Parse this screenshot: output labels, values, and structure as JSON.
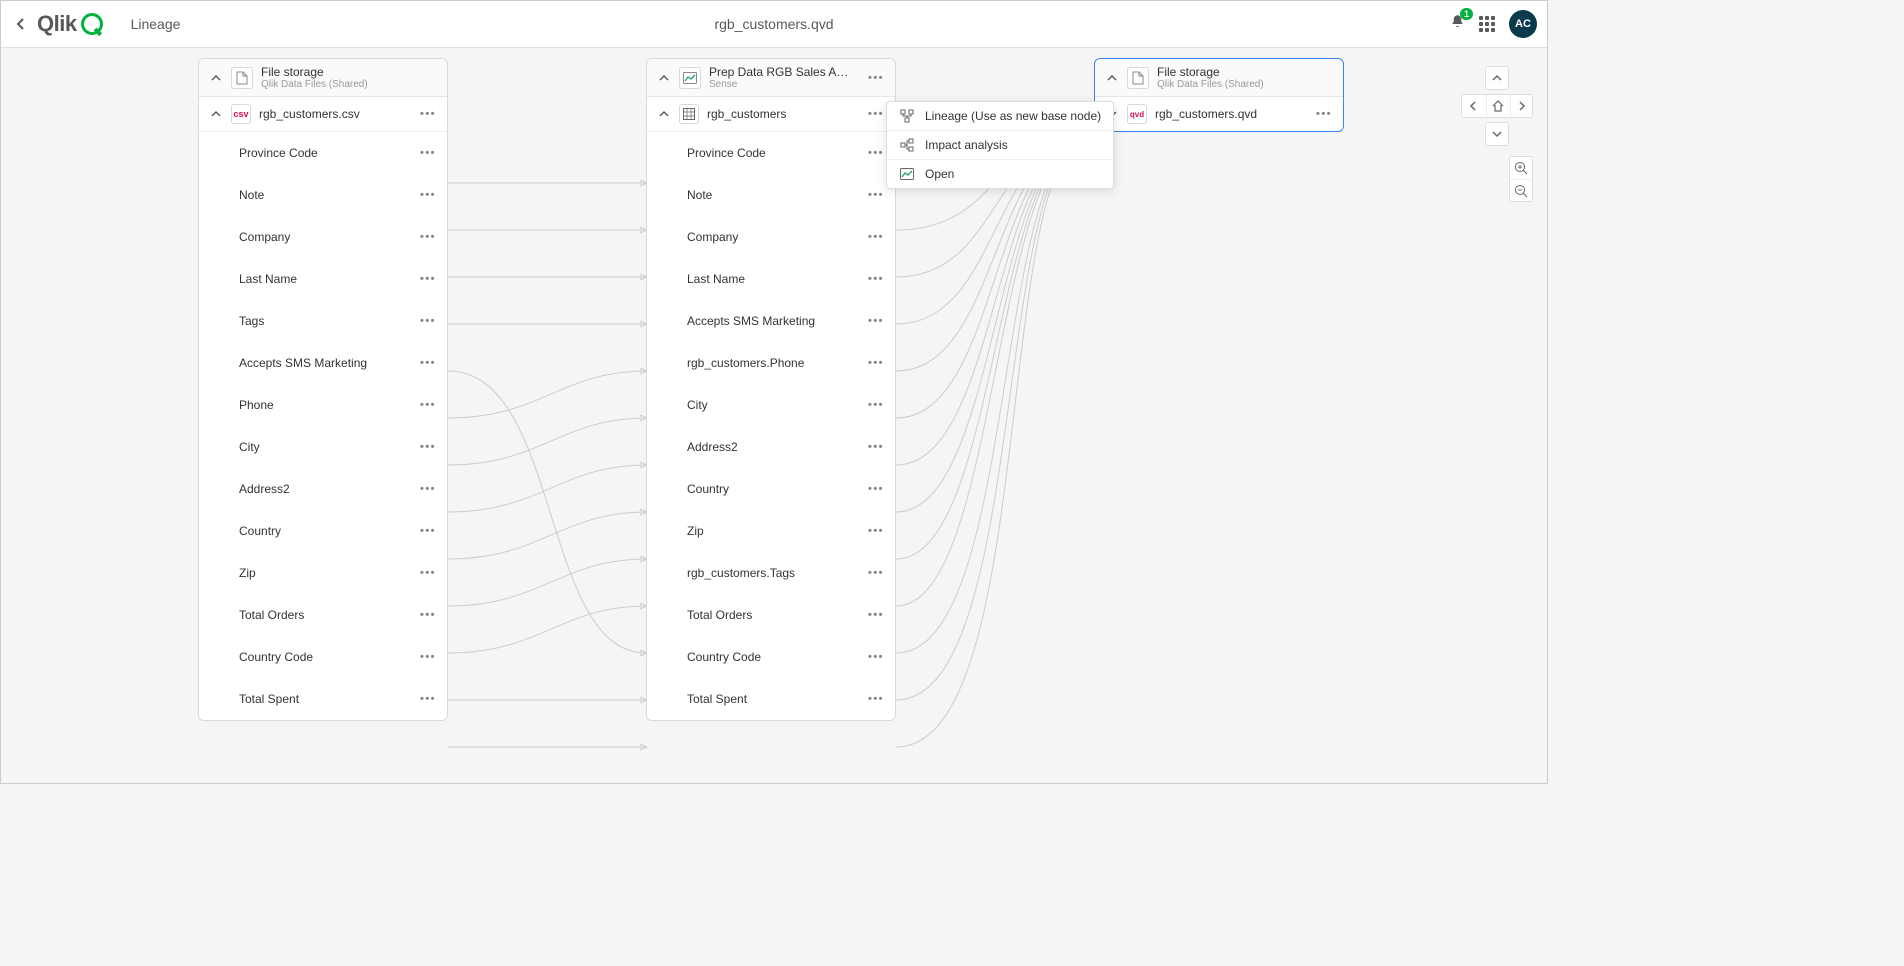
{
  "header": {
    "app_title": "Lineage",
    "doc_title": "rgb_customers.qvd",
    "notification_count": "1",
    "avatar_initials": "AC"
  },
  "nodes": {
    "left": {
      "title": "File storage",
      "subtitle": "Qlik Data Files (Shared)",
      "icon_name": "file-icon",
      "sub": {
        "label": "rgb_customers.csv",
        "badge": "csv"
      },
      "fields": [
        "Province Code",
        "Note",
        "Company",
        "Last Name",
        "Tags",
        "Accepts SMS Marketing",
        "Phone",
        "City",
        "Address2",
        "Country",
        "Zip",
        "Total Orders",
        "Country Code",
        "Total Spent"
      ]
    },
    "center": {
      "title": "Prep Data RGB Sales A…",
      "subtitle": "Sense",
      "icon_name": "chart-icon",
      "sub": {
        "label": "rgb_customers",
        "badge": ""
      },
      "fields": [
        "Province Code",
        "Note",
        "Company",
        "Last Name",
        "Accepts SMS Marketing",
        "rgb_customers.Phone",
        "City",
        "Address2",
        "Country",
        "Zip",
        "rgb_customers.Tags",
        "Total Orders",
        "Country Code",
        "Total Spent"
      ]
    },
    "right": {
      "title": "File storage",
      "subtitle": "Qlik Data Files (Shared)",
      "icon_name": "file-icon",
      "sub": {
        "label": "rgb_customers.qvd",
        "badge": "qvd"
      }
    }
  },
  "context_menu": {
    "items": [
      {
        "label": "Lineage (Use as new base node)",
        "icon": "lineage-icon"
      },
      {
        "label": "Impact analysis",
        "icon": "impact-icon"
      },
      {
        "label": "Open",
        "icon": "open-icon"
      }
    ]
  }
}
